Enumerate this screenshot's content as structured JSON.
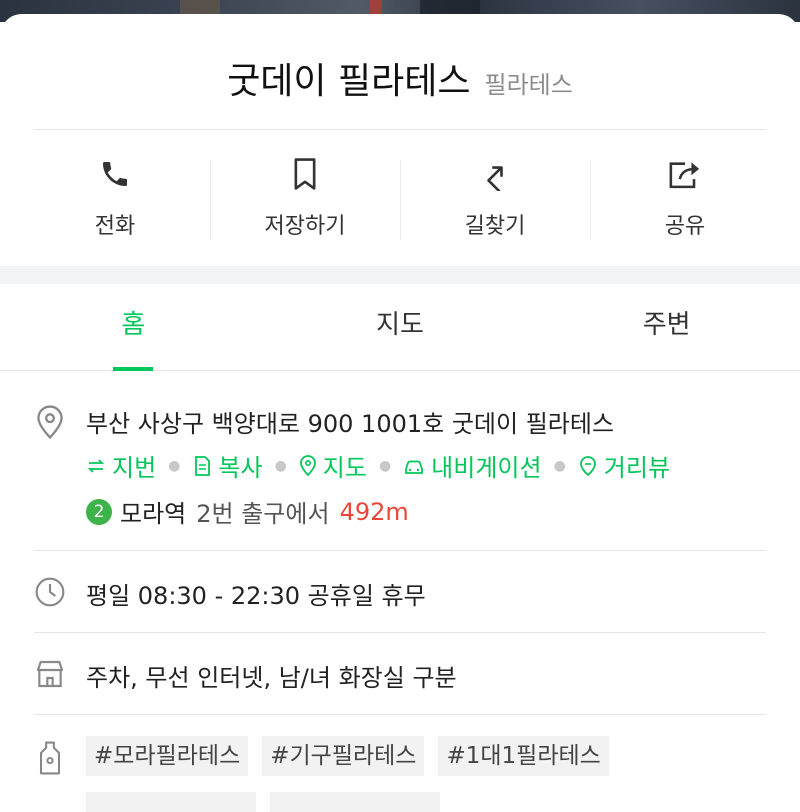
{
  "place": {
    "name": "굿데이 필라테스",
    "category": "필라테스"
  },
  "actions": [
    {
      "label": "전화",
      "icon": "phone-icon"
    },
    {
      "label": "저장하기",
      "icon": "bookmark-icon"
    },
    {
      "label": "길찾기",
      "icon": "directions-icon"
    },
    {
      "label": "공유",
      "icon": "share-icon"
    }
  ],
  "tabs": [
    {
      "label": "홈",
      "active": true
    },
    {
      "label": "지도",
      "active": false
    },
    {
      "label": "주변",
      "active": false
    }
  ],
  "address": {
    "text": "부산 사상구 백양대로 900 1001호 굿데이 필라테스",
    "links": [
      "지번",
      "복사",
      "지도",
      "내비게이션",
      "거리뷰"
    ]
  },
  "subway": {
    "line": "2",
    "line_color": "#3cb44a",
    "station": "모라역",
    "exit": "2번 출구에서",
    "distance": "492m"
  },
  "hours": "평일 08:30 - 22:30 공휴일 휴무",
  "amenities": "주차, 무선 인터넷, 남/녀 화장실 구분",
  "tags": [
    "#모라필라테스",
    "#기구필라테스",
    "#1대1필라테스"
  ],
  "colors": {
    "accent": "#03c75a",
    "distance": "#e8473a"
  }
}
